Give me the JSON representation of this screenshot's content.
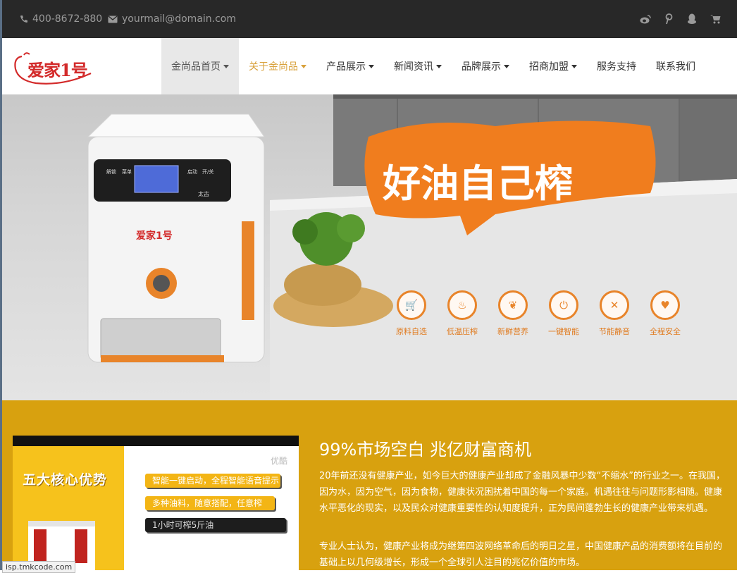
{
  "topbar": {
    "phone": "400-8672-880",
    "email": "yourmail@domain.com",
    "social_icons": [
      "weibo-icon",
      "pinterest-icon",
      "qq-icon",
      "cart-icon"
    ]
  },
  "logo": {
    "text": "爱家1号"
  },
  "nav": {
    "items": [
      {
        "label": "金尚品首页",
        "dropdown": true
      },
      {
        "label": "关于金尚品",
        "dropdown": true
      },
      {
        "label": "产品展示",
        "dropdown": true
      },
      {
        "label": "新闻资讯",
        "dropdown": true
      },
      {
        "label": "品牌展示",
        "dropdown": true
      },
      {
        "label": "招商加盟",
        "dropdown": true
      },
      {
        "label": "服务支持",
        "dropdown": false
      },
      {
        "label": "联系我们",
        "dropdown": false
      }
    ]
  },
  "banner": {
    "slogan": "好油自己榨",
    "features": [
      {
        "label": "原料自选",
        "icon": "basket-icon"
      },
      {
        "label": "低温压榨",
        "icon": "thermometer-icon"
      },
      {
        "label": "新鲜营养",
        "icon": "leaf-icon"
      },
      {
        "label": "一键智能",
        "icon": "power-icon"
      },
      {
        "label": "节能静音",
        "icon": "mute-icon"
      },
      {
        "label": "全程安全",
        "icon": "heart-icon"
      }
    ],
    "machine_brand": "爱家1号",
    "machine_buttons": [
      "解锁",
      "菜单",
      "启动",
      "开/关"
    ]
  },
  "promo": {
    "title": "五大核心优势",
    "tag": "优酷",
    "pills": [
      "智能一键启动，全程智能语音提示",
      "多种油料，随意搭配，任意榨",
      "1小时可榨5斤油"
    ]
  },
  "content": {
    "heading": "99%市场空白 兆亿财富商机",
    "paragraphs": [
      "20年前还没有健康产业，如今巨大的健康产业却成了金融风暴中少数“不缩水”的行业之一。在我国，因为水，因为空气，因为食物，健康状况困扰着中国的每一个家庭。机遇往往与问题形影相随。健康水平恶化的现实，以及民众对健康重要性的认知度提升，正为民间蓬勃生长的健康产业带来机遇。",
      "专业人士认为，健康产业将成为继第四波网络革命后的明日之星，中国健康产品的消费额将在目前的基础上以几何级增长，形成一个全球引人注目的兆亿价值的市场。"
    ]
  },
  "status": {
    "url": "isp.tmkcode.com"
  },
  "colors": {
    "accent": "#e8842a",
    "gold": "#d8a10f",
    "topbar": "#282828",
    "nav_highlight": "#d8a13b"
  }
}
